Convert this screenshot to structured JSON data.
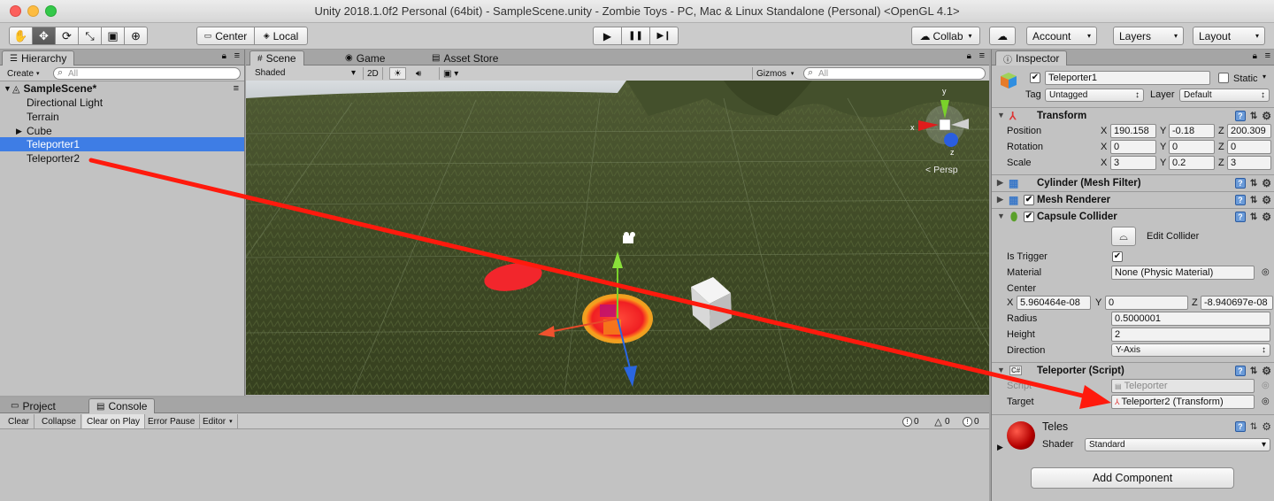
{
  "window": {
    "title": "Unity 2018.1.0f2 Personal (64bit) - SampleScene.unity - Zombie Toys - PC, Mac & Linux Standalone (Personal) <OpenGL 4.1>"
  },
  "toolbar": {
    "tools": [
      {
        "name": "hand-tool",
        "glyph": "✋"
      },
      {
        "name": "move-tool",
        "glyph": "✥"
      },
      {
        "name": "rotate-tool",
        "glyph": "⟳"
      },
      {
        "name": "scale-tool",
        "glyph": "⤡"
      },
      {
        "name": "rect-tool",
        "glyph": "▣"
      },
      {
        "name": "transform-tool",
        "glyph": "⊕"
      }
    ],
    "pivot_label": "Center",
    "space_label": "Local",
    "play_glyph": "▶",
    "pause_glyph": "❚❚",
    "step_glyph": "▶❙",
    "collab_label": "Collab",
    "account_label": "Account",
    "layers_label": "Layers",
    "layout_label": "Layout"
  },
  "hierarchy": {
    "tab_label": "Hierarchy",
    "create_label": "Create",
    "search_placeholder": "All",
    "scene_name": "SampleScene*",
    "items": [
      {
        "label": "Directional Light",
        "expandable": false,
        "selected": false
      },
      {
        "label": "Terrain",
        "expandable": false,
        "selected": false
      },
      {
        "label": "Cube",
        "expandable": true,
        "selected": false
      },
      {
        "label": "Teleporter1",
        "expandable": false,
        "selected": true
      },
      {
        "label": "Teleporter2",
        "expandable": false,
        "selected": false
      }
    ]
  },
  "scene_view": {
    "tabs": [
      "Scene",
      "Game",
      "Asset Store"
    ],
    "draw_mode": "Shaded",
    "mode_2d": "2D",
    "gizmos_label": "Gizmos",
    "search_placeholder": "All",
    "persp_label": "Persp",
    "axis_labels": {
      "x": "x",
      "y": "y",
      "z": "z"
    }
  },
  "console": {
    "tabs": [
      "Project",
      "Console"
    ],
    "buttons": [
      "Clear",
      "Collapse",
      "Clear on Play",
      "Error Pause",
      "Editor"
    ],
    "counts": {
      "info": "0",
      "warning": "0",
      "error": "0"
    }
  },
  "inspector": {
    "tab_label": "Inspector",
    "object_name": "Teleporter1",
    "static_label": "Static",
    "tag_label": "Tag",
    "tag_value": "Untagged",
    "layer_label": "Layer",
    "layer_value": "Default",
    "transform": {
      "title": "Transform",
      "position_label": "Position",
      "position": {
        "x": "190.158",
        "y": "-0.18",
        "z": "200.309"
      },
      "rotation_label": "Rotation",
      "rotation": {
        "x": "0",
        "y": "0",
        "z": "0"
      },
      "scale_label": "Scale",
      "scale": {
        "x": "3",
        "y": "0.2",
        "z": "3"
      }
    },
    "mesh_filter_title": "Cylinder (Mesh Filter)",
    "mesh_renderer_title": "Mesh Renderer",
    "capsule": {
      "title": "Capsule Collider",
      "edit_label": "Edit Collider",
      "is_trigger_label": "Is Trigger",
      "material_label": "Material",
      "material_value": "None (Physic Material)",
      "center_label": "Center",
      "center": {
        "x": "5.960464e-08",
        "y": "0",
        "z": "-8.940697e-08"
      },
      "radius_label": "Radius",
      "radius": "0.5000001",
      "height_label": "Height",
      "height": "2",
      "direction_label": "Direction",
      "direction": "Y-Axis"
    },
    "teleporter": {
      "title": "Teleporter (Script)",
      "script_label": "Script",
      "script_value": "Teleporter",
      "target_label": "Target",
      "target_value": "Teleporter2 (Transform)"
    },
    "material": {
      "name": "Teles",
      "shader_label": "Shader",
      "shader_value": "Standard"
    },
    "add_component_label": "Add Component"
  },
  "colors": {
    "selection": "#3e7de5",
    "annotation_arrow": "#ff1a0d",
    "panel_bg": "#c2c2c2"
  }
}
